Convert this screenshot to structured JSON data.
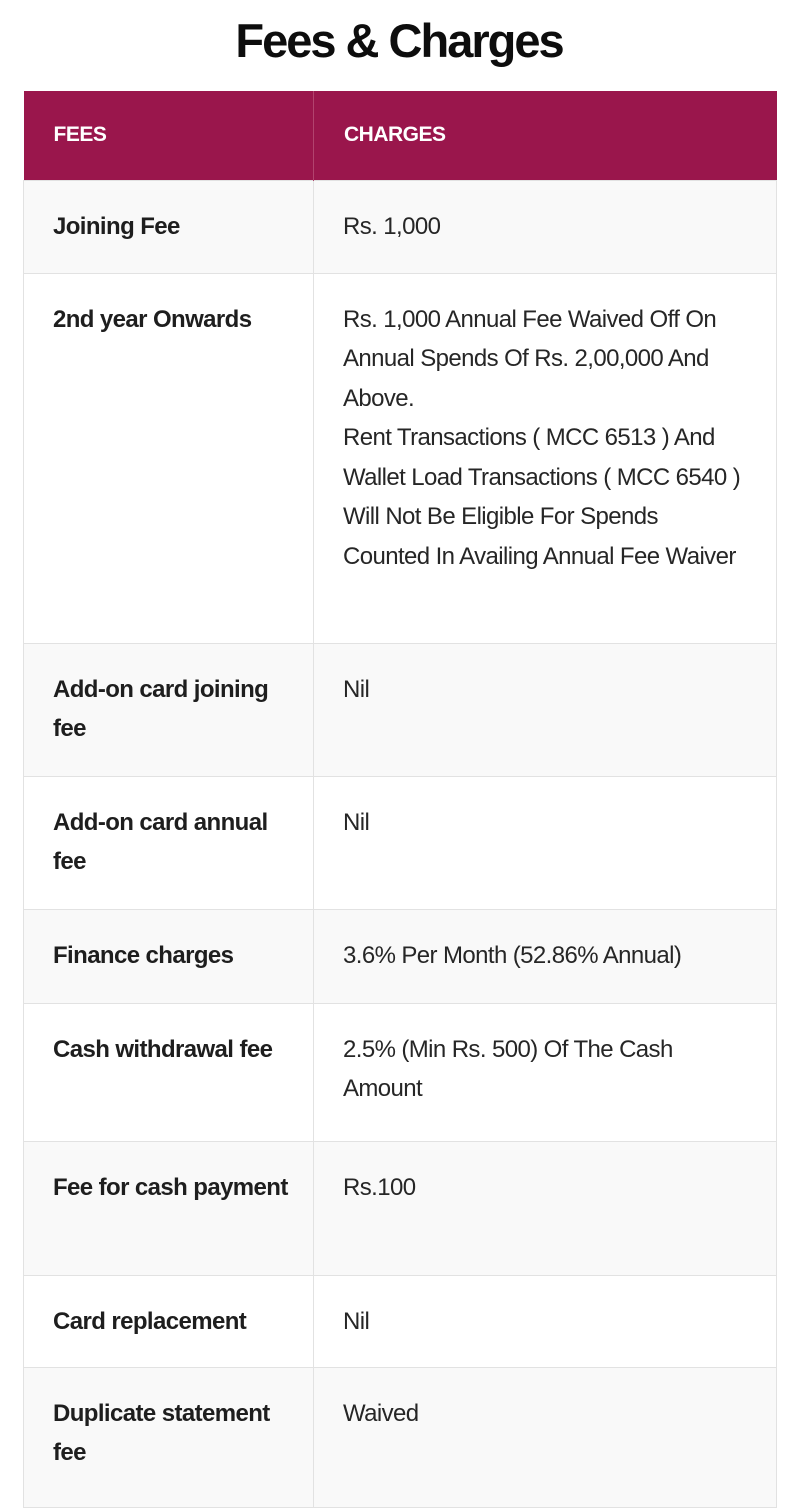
{
  "page": {
    "title": "Fees & Charges"
  },
  "table": {
    "header": {
      "fees": "FEES",
      "charges": "CHARGES"
    },
    "rows": [
      {
        "fee": "Joining Fee",
        "charge": [
          "Rs. 1,000"
        ]
      },
      {
        "fee": "2nd year Onwards",
        "charge": [
          "Rs. 1,000 Annual Fee Waived Off On Annual Spends Of Rs. 2,00,000 And Above.",
          "Rent Transactions ( MCC 6513 ) And Wallet Load Transactions ( MCC 6540 ) Will Not Be Eligible For Spends Counted In Availing Annual Fee Waiver"
        ]
      },
      {
        "fee": "Add-on card joining fee",
        "charge": [
          "Nil"
        ]
      },
      {
        "fee": "Add-on card annual fee",
        "charge": [
          "Nil"
        ]
      },
      {
        "fee": "Finance charges",
        "charge": [
          "3.6% Per Month (52.86% Annual)"
        ]
      },
      {
        "fee": "Cash withdrawal fee",
        "charge": [
          "2.5% (Min Rs. 500) Of The Cash Amount"
        ]
      },
      {
        "fee": "Fee for cash payment",
        "charge": [
          "Rs.100"
        ]
      },
      {
        "fee": "Card replacement",
        "charge": [
          "Nil"
        ]
      },
      {
        "fee": "Duplicate statement fee",
        "charge": [
          "Waived"
        ]
      }
    ]
  },
  "colors": {
    "header_background": "#9a164c",
    "header_text": "#ffffff",
    "row_alt_background": "#f9f9f9"
  }
}
